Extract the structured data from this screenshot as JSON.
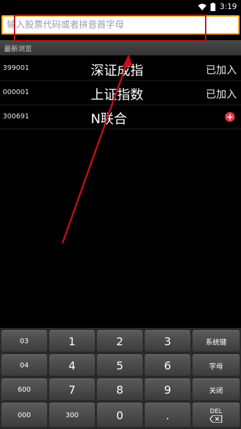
{
  "status_bar": {
    "time": "3:19",
    "wifi_icon": "wifi-icon",
    "battery_icon": "battery-icon"
  },
  "search": {
    "placeholder": "输入股票代码或者拼音首字母",
    "value": ""
  },
  "recent_header": "最新浏览",
  "rows": [
    {
      "code": "399001",
      "name": "深证成指",
      "status": "已加入"
    },
    {
      "code": "000001",
      "name": "上证指数",
      "status": "已加入"
    },
    {
      "code": "300691",
      "name": "N联合",
      "status": ""
    }
  ],
  "add_icon": "plus-circle-icon",
  "keyboard": {
    "rows": [
      [
        "03",
        "1",
        "2",
        "3",
        "系统键"
      ],
      [
        "04",
        "4",
        "5",
        "6",
        "字母"
      ],
      [
        "600",
        "7",
        "8",
        "9",
        "关闭"
      ],
      [
        "000",
        "300",
        "0",
        ".",
        "DEL"
      ]
    ]
  },
  "colors": {
    "search_border": "#ffa000",
    "annotation": "#c0101a",
    "add_button": "#e23a4a"
  }
}
